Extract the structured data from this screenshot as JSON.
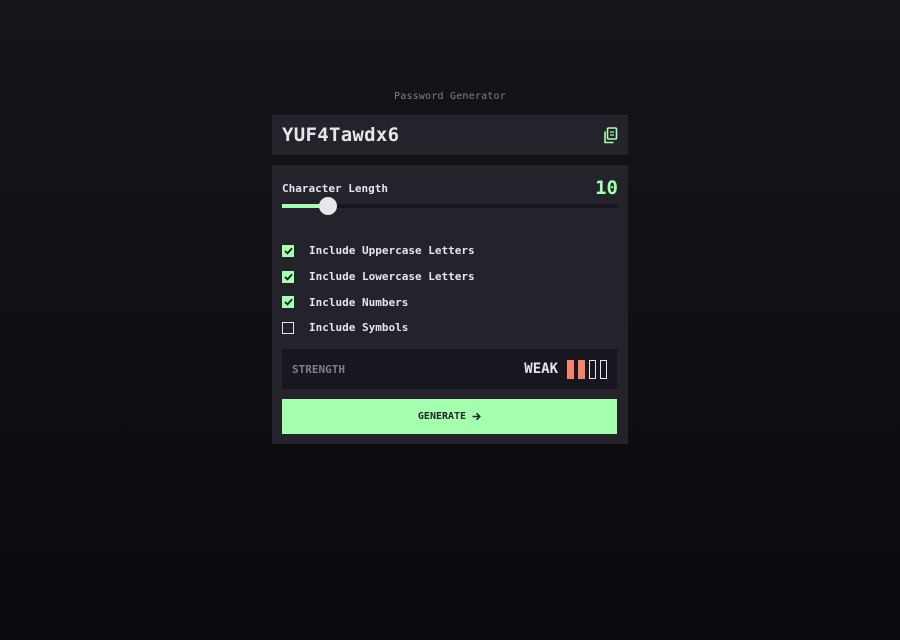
{
  "app": {
    "title": "Password Generator"
  },
  "password": {
    "value": "YUF4Tawdx6"
  },
  "length": {
    "label": "Character Length",
    "value": "10",
    "slider_fraction": 0.137
  },
  "options": [
    {
      "label": "Include Uppercase Letters",
      "checked": true
    },
    {
      "label": "Include Lowercase Letters",
      "checked": true
    },
    {
      "label": "Include Numbers",
      "checked": true
    },
    {
      "label": "Include Symbols",
      "checked": false
    }
  ],
  "strength": {
    "label": "STRENGTH",
    "value": "WEAK",
    "level": 2,
    "max_level": 4
  },
  "generate": {
    "label": "GENERATE"
  },
  "icons": {
    "copy": "copy-icon",
    "check": "check-icon",
    "arrow": "arrow-right-icon"
  },
  "colors": {
    "accent": "#a4ffaf",
    "panel": "#24232c",
    "strength_weak": "#f5866c",
    "text": "#e6e5ea",
    "muted": "#817d92"
  }
}
